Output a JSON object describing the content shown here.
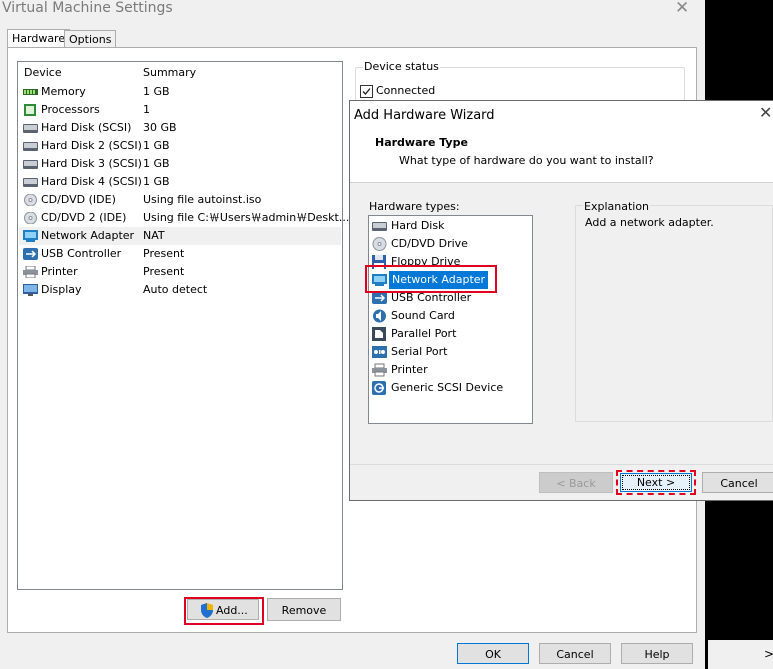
{
  "window": {
    "title": "Virtual Machine Settings",
    "close_glyph": "✕"
  },
  "tabs": [
    {
      "label": "Hardware"
    },
    {
      "label": "Options"
    }
  ],
  "device_list": {
    "col_device": "Device",
    "col_summary": "Summary",
    "rows": [
      {
        "name": "Memory",
        "summary": "1 GB",
        "icon": "memory-icon"
      },
      {
        "name": "Processors",
        "summary": "1",
        "icon": "processor-icon"
      },
      {
        "name": "Hard Disk (SCSI)",
        "summary": "30 GB",
        "icon": "hard-disk-icon"
      },
      {
        "name": "Hard Disk 2 (SCSI)",
        "summary": "1 GB",
        "icon": "hard-disk-icon"
      },
      {
        "name": "Hard Disk 3 (SCSI)",
        "summary": "1 GB",
        "icon": "hard-disk-icon"
      },
      {
        "name": "Hard Disk 4 (SCSI)",
        "summary": "1 GB",
        "icon": "hard-disk-icon"
      },
      {
        "name": "CD/DVD (IDE)",
        "summary": "Using file autoinst.iso",
        "icon": "cd-dvd-icon"
      },
      {
        "name": "CD/DVD 2 (IDE)",
        "summary": "Using file C:￦Users￦admin￦Deskt...",
        "icon": "cd-dvd-icon"
      },
      {
        "name": "Network Adapter",
        "summary": "NAT",
        "icon": "network-adapter-icon"
      },
      {
        "name": "USB Controller",
        "summary": "Present",
        "icon": "usb-icon"
      },
      {
        "name": "Printer",
        "summary": "Present",
        "icon": "printer-icon"
      },
      {
        "name": "Display",
        "summary": "Auto detect",
        "icon": "display-icon"
      }
    ]
  },
  "buttons": {
    "add": "Add...",
    "remove": "Remove",
    "ok": "OK",
    "cancel": "Cancel",
    "help": "Help"
  },
  "device_status": {
    "legend": "Device status",
    "connected": "Connected"
  },
  "wizard": {
    "title": "Add Hardware Wizard",
    "close_glyph": "✕",
    "heading": "Hardware Type",
    "subheading": "What type of hardware do you want to install?",
    "types_label": "Hardware types:",
    "explanation_label": "Explanation",
    "explanation_text": "Add a network adapter.",
    "types": [
      {
        "label": "Hard Disk",
        "icon": "hard-disk-icon"
      },
      {
        "label": "CD/DVD Drive",
        "icon": "cd-dvd-icon"
      },
      {
        "label": "Floppy Drive",
        "icon": "floppy-icon"
      },
      {
        "label": "Network Adapter",
        "icon": "network-adapter-icon"
      },
      {
        "label": "USB Controller",
        "icon": "usb-icon"
      },
      {
        "label": "Sound Card",
        "icon": "sound-card-icon"
      },
      {
        "label": "Parallel Port",
        "icon": "parallel-port-icon"
      },
      {
        "label": "Serial Port",
        "icon": "serial-port-icon"
      },
      {
        "label": "Printer",
        "icon": "printer-icon"
      },
      {
        "label": "Generic SCSI Device",
        "icon": "scsi-device-icon"
      }
    ],
    "back": "< Back",
    "next": "Next >",
    "cancel": "Cancel"
  },
  "edge_glyph": ">"
}
